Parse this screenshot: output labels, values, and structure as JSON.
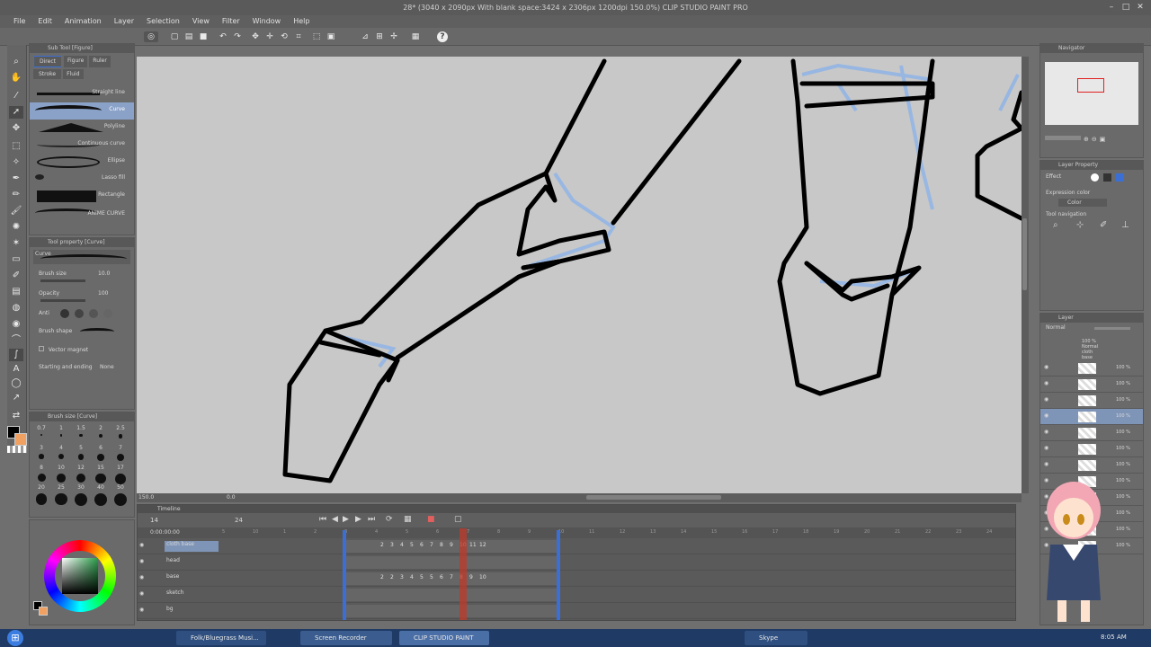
{
  "window": {
    "title": "28* (3040 x 2090px With blank space:3424 x 2306px 1200dpi 150.0%)  CLIP STUDIO PAINT PRO"
  },
  "menu": [
    "File",
    "Edit",
    "Animation",
    "Layer",
    "Selection",
    "View",
    "Filter",
    "Window",
    "Help"
  ],
  "sub_tool": {
    "title": "Sub Tool [Figure]",
    "tabs": [
      "Direct",
      "Figure",
      "Ruler",
      "Stroke",
      "Fluid"
    ],
    "items": [
      "Straight line",
      "Curve",
      "Polyline",
      "Continuous curve",
      "Ellipse",
      "Lasso fill",
      "Rectangle",
      "ANIME CURVE"
    ]
  },
  "tool_property": {
    "title": "Tool property [Curve]",
    "tool_name": "Curve",
    "brush_size_label": "Brush size",
    "brush_size_value": "10.0",
    "opacity_label": "Opacity",
    "opacity_value": "100",
    "anti_label": "Anti",
    "brush_shape_label": "Brush shape",
    "vector_magnet_label": "Vector magnet",
    "starting_ending_label": "Starting and ending",
    "starting_ending_value": "None"
  },
  "brush_size_panel": {
    "title": "Brush size [Curve]",
    "sizes": [
      "0.7",
      "1",
      "1.5",
      "2",
      "2.5",
      "3",
      "4",
      "5",
      "6",
      "7",
      "8",
      "10",
      "12",
      "15",
      "17",
      "20",
      "25",
      "30",
      "40",
      "50"
    ]
  },
  "navigator": {
    "title": "Navigator"
  },
  "layer_property": {
    "title": "Layer Property",
    "effect_label": "Effect",
    "expression_color_label": "Expression color",
    "expression_color_value": "Color",
    "tool_navigation_label": "Tool navigation"
  },
  "layer_panel": {
    "title": "Layer",
    "blend_mode": "Normal",
    "folder_label": "100 % Normal",
    "folder_name": "cloth base",
    "rows": [
      "100 %",
      "100 %",
      "100 %",
      "100 %",
      "100 %",
      "100 %",
      "100 %",
      "100 %",
      "100 %",
      "100 %",
      "100 %",
      "100 %"
    ]
  },
  "status": {
    "zoom": "150.0",
    "canvas_offset": "0.0"
  },
  "timeline": {
    "title": "Timeline",
    "frame_current": "14",
    "fps": "24",
    "timecode": "0:00:00:00",
    "tracks": [
      "cloth base",
      "head",
      "base",
      "sketch",
      "bg"
    ],
    "ruler": [
      "5",
      "10",
      "1",
      "2",
      "3",
      "4",
      "5",
      "6",
      "7",
      "8",
      "9",
      "10",
      "11",
      "12",
      "13",
      "14",
      "15",
      "16",
      "17",
      "18",
      "19",
      "20",
      "21",
      "22",
      "23",
      "24"
    ],
    "cells_track1": [
      "2",
      "3",
      "4",
      "5",
      "6",
      "7",
      "8",
      "9",
      "10",
      "11",
      "12"
    ],
    "cells_track3": [
      "2",
      "2",
      "3",
      "4",
      "5",
      "5",
      "6",
      "7",
      "8",
      "9",
      "10"
    ]
  },
  "taskbar": {
    "items": [
      "Folk/Bluegrass Musi...",
      "Screen Recorder",
      "CLIP STUDIO PAINT",
      "Skype"
    ],
    "clock": "8:05 AM"
  },
  "colors": {
    "accent_blue": "#3b6fd6",
    "timeline_red": "#c0392b",
    "canvas_bg": "#c8c8c8",
    "sketch_blue": "#8fb4e6"
  }
}
